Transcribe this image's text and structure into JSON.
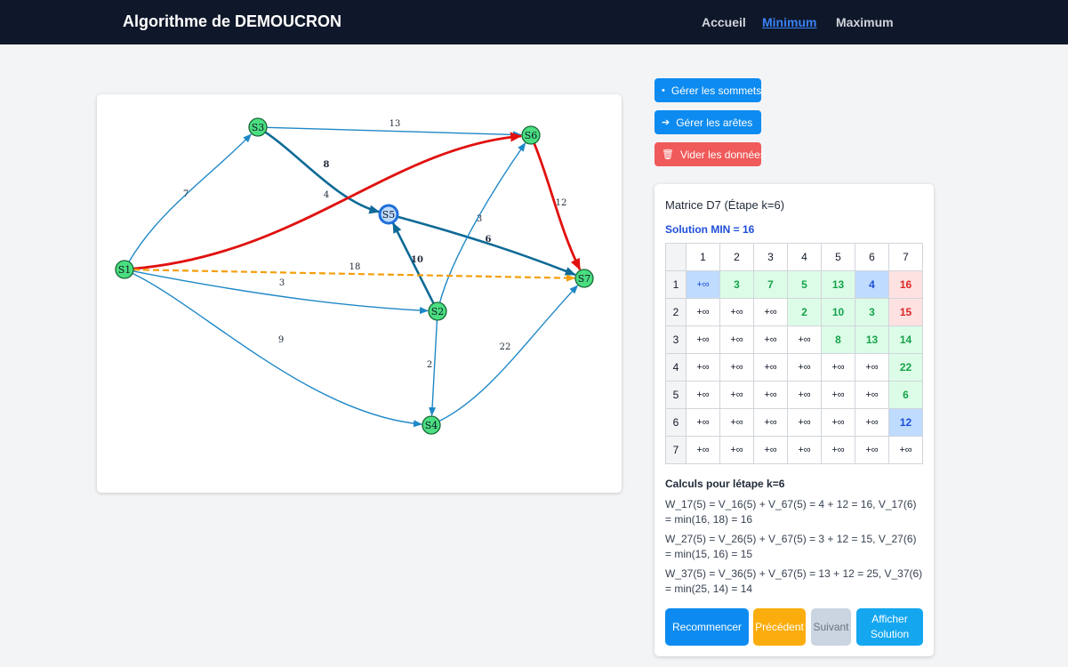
{
  "app": {
    "title": "Algorithme de DEMOUCRON",
    "nav": [
      {
        "label": "Accueil",
        "active": false
      },
      {
        "label": "Minimum",
        "active": true
      },
      {
        "label": "Maximum",
        "active": false
      }
    ]
  },
  "graph": {
    "nodes": [
      {
        "id": "S1",
        "label": "S1"
      },
      {
        "id": "S2",
        "label": "S2"
      },
      {
        "id": "S3",
        "label": "S3"
      },
      {
        "id": "S4",
        "label": "S4"
      },
      {
        "id": "S5",
        "label": "S5",
        "current": true
      },
      {
        "id": "S6",
        "label": "S6"
      },
      {
        "id": "S7",
        "label": "S7"
      }
    ],
    "edges": [
      {
        "from": "S1",
        "to": "S3",
        "weight": "7",
        "style": "normal"
      },
      {
        "from": "S3",
        "to": "S6",
        "weight": "13",
        "style": "normal"
      },
      {
        "from": "S3",
        "to": "S5",
        "weight": "8",
        "style": "bold"
      },
      {
        "from": "S1",
        "to": "S6",
        "weight": "4",
        "style": "path"
      },
      {
        "from": "S5",
        "to": "S7",
        "weight": "6",
        "style": "bold"
      },
      {
        "from": "S2",
        "to": "S6",
        "weight": "3",
        "style": "normal"
      },
      {
        "from": "S2",
        "to": "S5",
        "weight": "10",
        "style": "bold"
      },
      {
        "from": "S1",
        "to": "S7",
        "weight": "18",
        "style": "dashed"
      },
      {
        "from": "S1",
        "to": "S2",
        "weight": "3",
        "style": "normal"
      },
      {
        "from": "S1",
        "to": "S4",
        "weight": "9",
        "style": "normal"
      },
      {
        "from": "S2",
        "to": "S4",
        "weight": "2",
        "style": "normal"
      },
      {
        "from": "S4",
        "to": "S7",
        "weight": "22",
        "style": "normal"
      },
      {
        "from": "S6",
        "to": "S7",
        "weight": "12",
        "style": "path"
      }
    ],
    "colors": {
      "node_fill": "#4ade80",
      "node_stroke": "#166534",
      "current_node_fill": "#bfdbfe",
      "current_node_stroke": "#1e6fd9",
      "edge_normal": "#1e88c7",
      "edge_bold": "#0e6a96",
      "edge_path": "#e0110f",
      "edge_dashed": "#f59e0b"
    }
  },
  "actions": {
    "manage_vertices": "Gérer les sommets",
    "manage_edges": "Gérer les arêtes",
    "clear_data": "Vider les données"
  },
  "matrix": {
    "title": "Matrice D7 (Étape k=6)",
    "solution": "Solution MIN = 16",
    "columns": [
      "1",
      "2",
      "3",
      "4",
      "5",
      "6",
      "7"
    ],
    "rows": [
      {
        "label": "1",
        "cells": [
          {
            "v": "+∞",
            "s": "infblue"
          },
          {
            "v": "3",
            "s": "green"
          },
          {
            "v": "7",
            "s": "green"
          },
          {
            "v": "5",
            "s": "green"
          },
          {
            "v": "13",
            "s": "green"
          },
          {
            "v": "4",
            "s": "blue"
          },
          {
            "v": "16",
            "s": "red"
          }
        ]
      },
      {
        "label": "2",
        "cells": [
          {
            "v": "+∞",
            "s": ""
          },
          {
            "v": "+∞",
            "s": ""
          },
          {
            "v": "+∞",
            "s": ""
          },
          {
            "v": "2",
            "s": "green"
          },
          {
            "v": "10",
            "s": "green"
          },
          {
            "v": "3",
            "s": "green"
          },
          {
            "v": "15",
            "s": "red"
          }
        ]
      },
      {
        "label": "3",
        "cells": [
          {
            "v": "+∞",
            "s": ""
          },
          {
            "v": "+∞",
            "s": ""
          },
          {
            "v": "+∞",
            "s": ""
          },
          {
            "v": "+∞",
            "s": ""
          },
          {
            "v": "8",
            "s": "green"
          },
          {
            "v": "13",
            "s": "green"
          },
          {
            "v": "14",
            "s": "green"
          }
        ]
      },
      {
        "label": "4",
        "cells": [
          {
            "v": "+∞",
            "s": ""
          },
          {
            "v": "+∞",
            "s": ""
          },
          {
            "v": "+∞",
            "s": ""
          },
          {
            "v": "+∞",
            "s": ""
          },
          {
            "v": "+∞",
            "s": ""
          },
          {
            "v": "+∞",
            "s": ""
          },
          {
            "v": "22",
            "s": "green"
          }
        ]
      },
      {
        "label": "5",
        "cells": [
          {
            "v": "+∞",
            "s": ""
          },
          {
            "v": "+∞",
            "s": ""
          },
          {
            "v": "+∞",
            "s": ""
          },
          {
            "v": "+∞",
            "s": ""
          },
          {
            "v": "+∞",
            "s": ""
          },
          {
            "v": "+∞",
            "s": ""
          },
          {
            "v": "6",
            "s": "green"
          }
        ]
      },
      {
        "label": "6",
        "cells": [
          {
            "v": "+∞",
            "s": ""
          },
          {
            "v": "+∞",
            "s": ""
          },
          {
            "v": "+∞",
            "s": ""
          },
          {
            "v": "+∞",
            "s": ""
          },
          {
            "v": "+∞",
            "s": ""
          },
          {
            "v": "+∞",
            "s": ""
          },
          {
            "v": "12",
            "s": "blue"
          }
        ]
      },
      {
        "label": "7",
        "cells": [
          {
            "v": "+∞",
            "s": ""
          },
          {
            "v": "+∞",
            "s": ""
          },
          {
            "v": "+∞",
            "s": ""
          },
          {
            "v": "+∞",
            "s": ""
          },
          {
            "v": "+∞",
            "s": ""
          },
          {
            "v": "+∞",
            "s": ""
          },
          {
            "v": "+∞",
            "s": ""
          }
        ]
      }
    ],
    "calc_title": "Calculs pour létape k=6",
    "calc_lines": [
      "W_17(5) = V_16(5) + V_67(5) = 4 + 12 = 16, V_17(6) = min(16, 18) = 16",
      "W_27(5) = V_26(5) + V_67(5) = 3 + 12 = 15, V_27(6) = min(15, 16) = 15",
      "W_37(5) = V_36(5) + V_67(5) = 13 + 12 = 25, V_37(6) = min(25, 14) = 14"
    ]
  },
  "controls": {
    "restart": "Recommencer",
    "previous": "Précédent",
    "next": "Suivant",
    "show_solution": "Afficher Solution"
  }
}
